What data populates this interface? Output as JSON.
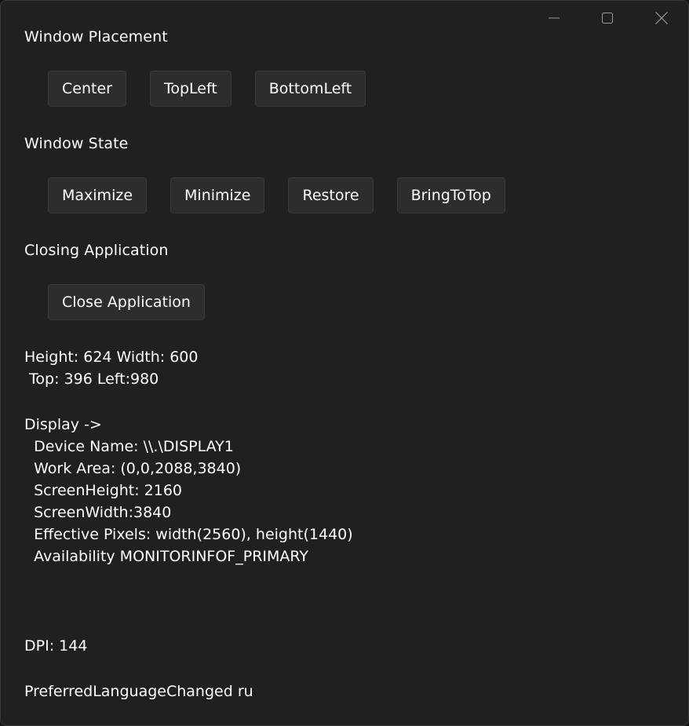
{
  "caption": {
    "minimize_icon": "minimize-icon",
    "maximize_icon": "maximize-icon",
    "close_icon": "close-icon"
  },
  "placement": {
    "title": "Window Placement",
    "buttons": [
      "Center",
      "TopLeft",
      "BottomLeft"
    ]
  },
  "state": {
    "title": "Window State",
    "buttons": [
      "Maximize",
      "Minimize",
      "Restore",
      "BringToTop"
    ]
  },
  "closing": {
    "title": "Closing Application",
    "button": "Close Application"
  },
  "size_info": {
    "line1": "Height: 624 Width: 600",
    "line2": " Top: 396 Left:980"
  },
  "display": {
    "header": "Display ->",
    "device_name": "  Device Name: \\\\.\\DISPLAY1",
    "work_area": "  Work Area: (0,0,2088,3840)",
    "screen_height": "  ScreenHeight: 2160",
    "screen_width": "  ScreenWidth:3840",
    "effective_pixels": "  Effective Pixels: width(2560), height(1440)",
    "availability": "  Availability MONITORINFOF_PRIMARY"
  },
  "dpi": "DPI: 144",
  "language": "PreferredLanguageChanged ru"
}
